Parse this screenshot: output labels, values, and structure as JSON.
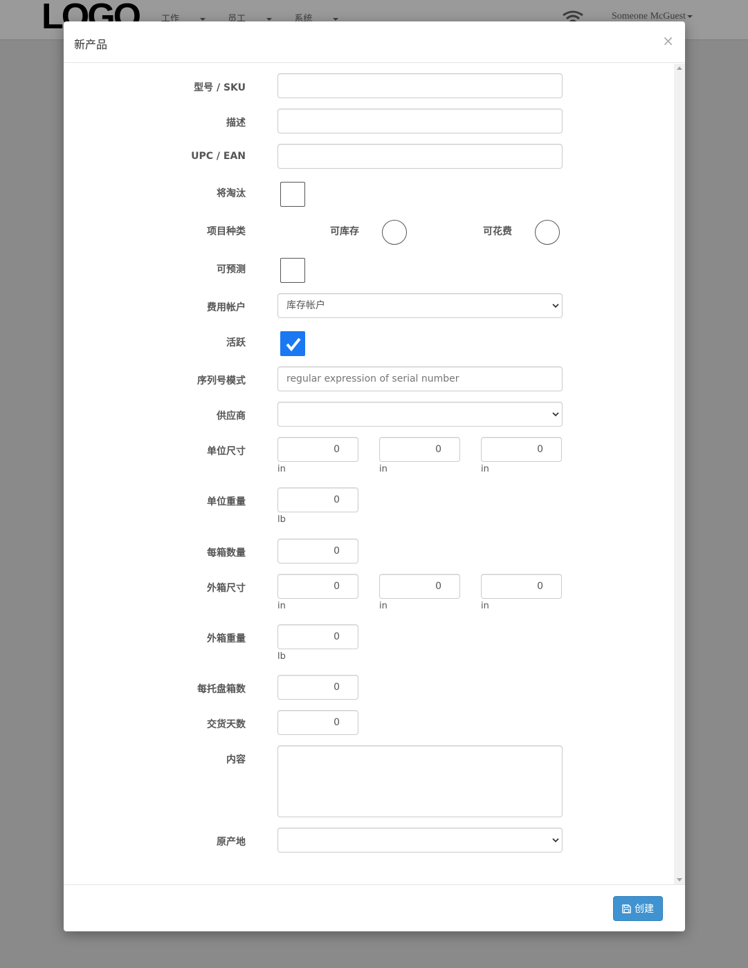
{
  "navbar": {
    "logo": "LOGO",
    "menu": [
      "工作",
      "员工",
      "系统"
    ],
    "user": "Someone McGuest"
  },
  "modal": {
    "title": "新产品",
    "close": "×",
    "footer": {
      "create_label": "创建"
    }
  },
  "form": {
    "sku": {
      "label": "型号 / SKU",
      "value": ""
    },
    "description": {
      "label": "描述",
      "value": ""
    },
    "upc": {
      "label": "UPC / EAN",
      "value": ""
    },
    "eol": {
      "label": "将淘汰",
      "checked": false
    },
    "item_type": {
      "label": "项目种类",
      "options": [
        "可库存",
        "可花费"
      ]
    },
    "forecastable": {
      "label": "可预测",
      "checked": false
    },
    "expense_account": {
      "label": "费用帐户",
      "value": "库存帐户"
    },
    "active": {
      "label": "活跃",
      "checked": true
    },
    "serial_pattern": {
      "label": "序列号模式",
      "placeholder": "regular expression of serial number"
    },
    "supplier": {
      "label": "供应商",
      "value": ""
    },
    "unit_dims": {
      "label": "单位尺寸",
      "values": [
        "0",
        "0",
        "0"
      ],
      "units": [
        "in",
        "in",
        "in"
      ]
    },
    "unit_weight": {
      "label": "单位重量",
      "value": "0",
      "unit": "lb"
    },
    "qty_per_box": {
      "label": "每箱数量",
      "value": "0"
    },
    "box_dims": {
      "label": "外箱尺寸",
      "values": [
        "0",
        "0",
        "0"
      ],
      "units": [
        "in",
        "in",
        "in"
      ]
    },
    "box_weight": {
      "label": "外箱重量",
      "value": "0",
      "unit": "lb"
    },
    "boxes_per_pallet": {
      "label": "每托盘箱数",
      "value": "0"
    },
    "lead_days": {
      "label": "交货天数",
      "value": "0"
    },
    "content": {
      "label": "内容",
      "value": ""
    },
    "origin": {
      "label": "原产地",
      "value": ""
    }
  },
  "colors": {
    "primary": "#3f93d0",
    "checkbox_checked": "#1a78f2"
  }
}
